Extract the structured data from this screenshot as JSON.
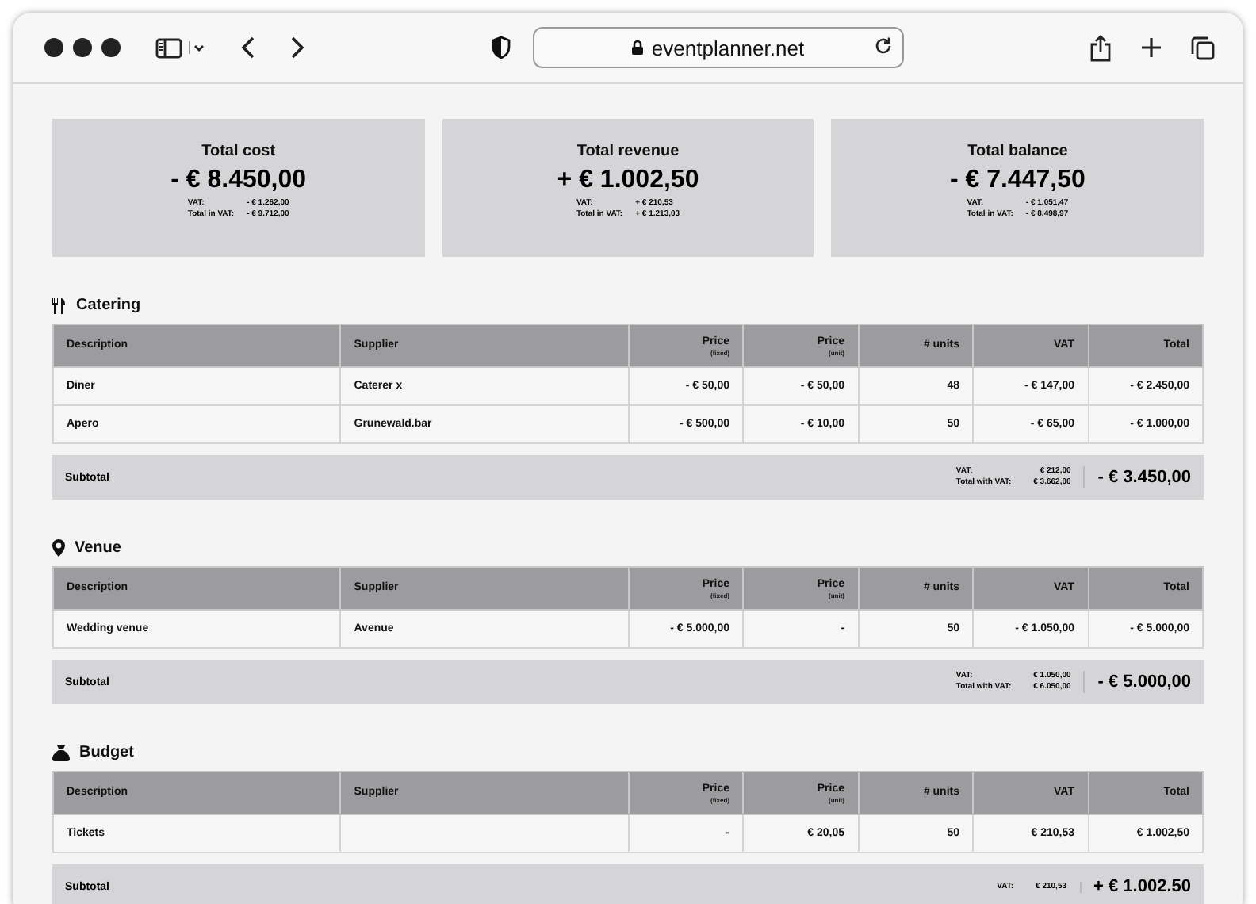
{
  "browser": {
    "url": "eventplanner.net"
  },
  "summary": [
    {
      "title": "Total cost",
      "amount": "- € 8.450,00",
      "vat_label": "VAT:",
      "vat": "- € 1.262,00",
      "total_label": "Total in VAT:",
      "total": "- € 9.712,00"
    },
    {
      "title": "Total revenue",
      "amount": "+ € 1.002,50",
      "vat_label": "VAT:",
      "vat": "+ € 210,53",
      "total_label": "Total in VAT:",
      "total": "+ € 1.213,03"
    },
    {
      "title": "Total balance",
      "amount": "- € 7.447,50",
      "vat_label": "VAT:",
      "vat": "- € 1.051,47",
      "total_label": "Total in VAT:",
      "total": "- € 8.498,97"
    }
  ],
  "sections": [
    {
      "kind": "catering",
      "title": "Catering",
      "columns": [
        {
          "label": "Description"
        },
        {
          "label": "Supplier"
        },
        {
          "label": "Price",
          "sublabel": "(fixed)"
        },
        {
          "label": "Price",
          "sublabel": "(unit)"
        },
        {
          "label": "# units"
        },
        {
          "label": "VAT"
        },
        {
          "label": "Total"
        }
      ],
      "rows": [
        {
          "description": "Diner",
          "supplier": "Caterer x",
          "price_fixed": "- € 50,00",
          "price_unit": "- € 50,00",
          "units": "48",
          "vat": "- € 147,00",
          "total": "- € 2.450,00"
        },
        {
          "description": "Apero",
          "supplier": "Grunewald.bar",
          "price_fixed": "- € 500,00",
          "price_unit": "- € 10,00",
          "units": "50",
          "vat": "- € 65,00",
          "total": "- € 1.000,00"
        }
      ],
      "subtotal": {
        "label": "Subtotal",
        "vat_label": "VAT:",
        "vat": "€ 212,00",
        "total_label": "Total with VAT:",
        "total_with_vat": "€ 3.662,00",
        "amount": "- € 3.450,00"
      }
    },
    {
      "kind": "venue",
      "title": "Venue",
      "columns": [
        {
          "label": "Description"
        },
        {
          "label": "Supplier"
        },
        {
          "label": "Price",
          "sublabel": "(fixed)"
        },
        {
          "label": "Price",
          "sublabel": "(unit)"
        },
        {
          "label": "# units"
        },
        {
          "label": "VAT"
        },
        {
          "label": "Total"
        }
      ],
      "rows": [
        {
          "description": "Wedding venue",
          "supplier": "Avenue",
          "price_fixed": "- € 5.000,00",
          "price_unit": "-",
          "units": "50",
          "vat": "- € 1.050,00",
          "total": "- € 5.000,00"
        }
      ],
      "subtotal": {
        "label": "Subtotal",
        "vat_label": "VAT:",
        "vat": "€ 1.050,00",
        "total_label": "Total with VAT:",
        "total_with_vat": "€ 6.050,00",
        "amount": "- € 5.000,00"
      }
    },
    {
      "kind": "budget",
      "title": "Budget",
      "columns": [
        {
          "label": "Description"
        },
        {
          "label": "Supplier"
        },
        {
          "label": "Price",
          "sublabel": "(fixed)"
        },
        {
          "label": "Price",
          "sublabel": "(unit)"
        },
        {
          "label": "# units"
        },
        {
          "label": "VAT"
        },
        {
          "label": "Total"
        }
      ],
      "rows": [
        {
          "description": "Tickets",
          "price_fixed": "-",
          "price_unit": "€ 20,05",
          "units": "50",
          "vat": "€ 210,53",
          "total": "€ 1.002,50"
        }
      ],
      "subtotal": {
        "label": "Subtotal",
        "vat_label": "VAT:",
        "vat": "€ 210,53",
        "amount": "+ € 1.002.50"
      }
    }
  ]
}
